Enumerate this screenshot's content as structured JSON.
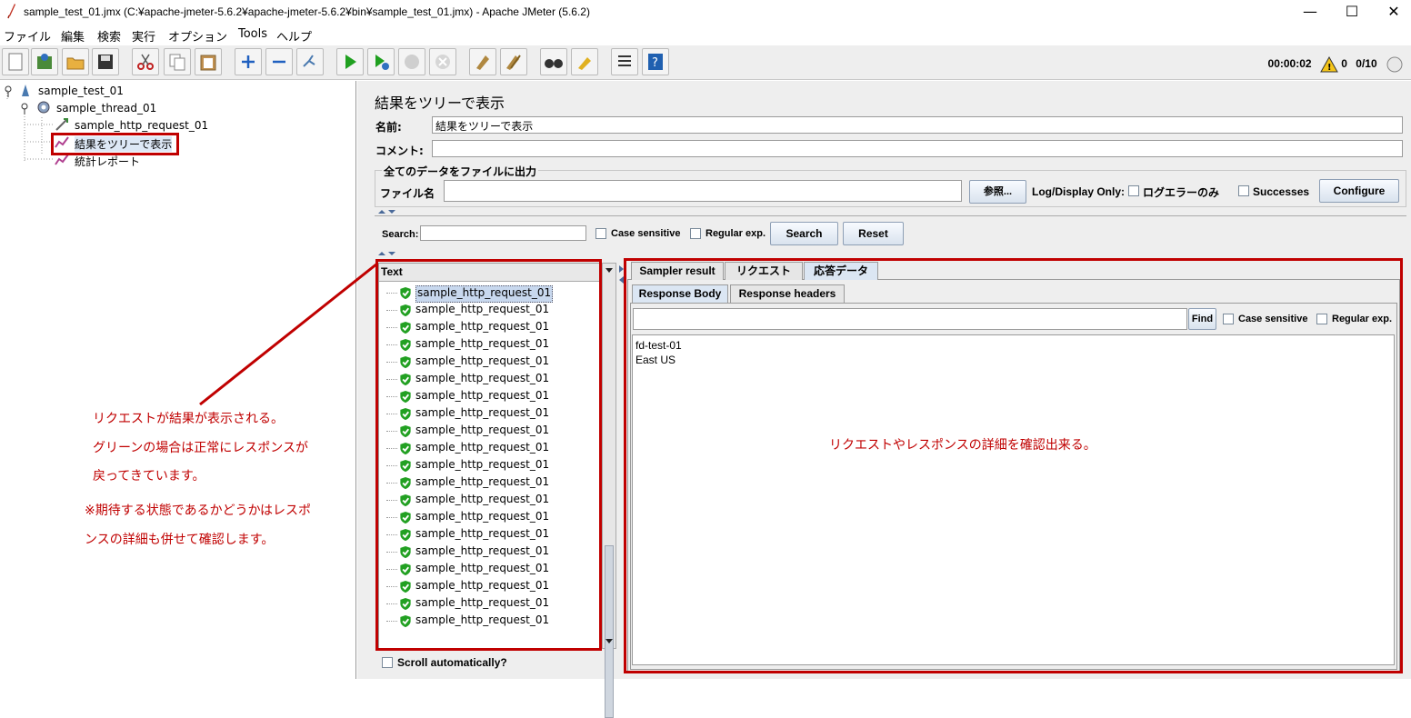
{
  "window": {
    "title": "sample_test_01.jmx (C:¥apache-jmeter-5.6.2¥apache-jmeter-5.6.2¥bin¥sample_test_01.jmx) - Apache JMeter (5.6.2)",
    "minimize": "—",
    "maximize": "☐",
    "close": "✕"
  },
  "menu": [
    "ファイル",
    "編集",
    "検索",
    "実行",
    "オプション",
    "Tools",
    "ヘルプ"
  ],
  "status": {
    "elapsed": "00:00:02",
    "warnings": "0",
    "threads": "0/10"
  },
  "tree": {
    "root": "sample_test_01",
    "thread": "sample_thread_01",
    "request": "sample_http_request_01",
    "listener": "結果をツリーで表示",
    "report": "統計レポート"
  },
  "panel": {
    "title": "結果をツリーで表示",
    "name_label": "名前:",
    "name_value": "結果をツリーで表示",
    "comment_label": "コメント:",
    "comment_value": "",
    "group_label": "全てのデータをファイルに出力",
    "file_label": "ファイル名",
    "file_value": "",
    "browse_label": "参照...",
    "log_display_label": "Log/Display Only:",
    "errors_label": "ログエラーのみ",
    "successes_label": "Successes",
    "configure_label": "Configure",
    "search_label": "Search:",
    "search_value": "",
    "case_label": "Case sensitive",
    "regex_label": "Regular exp.",
    "search_button": "Search",
    "reset_button": "Reset"
  },
  "results": {
    "header": "Text",
    "items": [
      "sample_http_request_01",
      "sample_http_request_01",
      "sample_http_request_01",
      "sample_http_request_01",
      "sample_http_request_01",
      "sample_http_request_01",
      "sample_http_request_01",
      "sample_http_request_01",
      "sample_http_request_01",
      "sample_http_request_01",
      "sample_http_request_01",
      "sample_http_request_01",
      "sample_http_request_01",
      "sample_http_request_01",
      "sample_http_request_01",
      "sample_http_request_01",
      "sample_http_request_01",
      "sample_http_request_01",
      "sample_http_request_01",
      "sample_http_request_01"
    ],
    "scroll_label": "Scroll automatically?"
  },
  "detail": {
    "tabs": [
      "Sampler result",
      "リクエスト",
      "応答データ"
    ],
    "subtabs": [
      "Response Body",
      "Response headers"
    ],
    "find_label": "Find",
    "case_label": "Case sensitive",
    "regex_label": "Regular exp.",
    "body_lines": [
      "fd-test-01",
      "East US"
    ]
  },
  "annotations": {
    "left_lines": [
      "リクエストが結果が表示される。",
      "グリーンの場合は正常にレスポンスが",
      "戻ってきています。",
      "※期待する状態であるかどうかはレスポ",
      "ンスの詳細も併せて確認します。"
    ],
    "right_text": "リクエストやレスポンスの詳細を確認出来る。",
    "color": "#c00000"
  }
}
